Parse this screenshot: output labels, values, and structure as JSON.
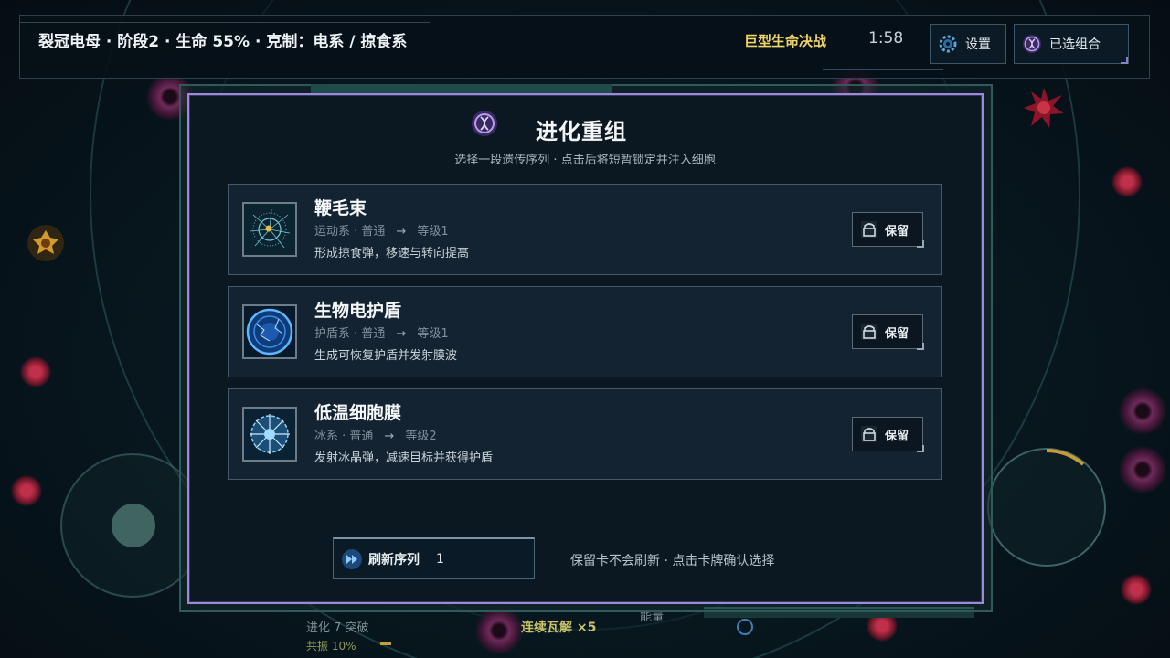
{
  "hud": {
    "boss_info": "裂冠电母 · 阶段2 · 生命 55% · 克制：电系 / 掠食系",
    "battle_name": "巨型生命决战",
    "timer": "1:58",
    "settings_label": "设置",
    "selected_combo_label": "已选组合",
    "bottom": {
      "evolution_text": "进化 7 突破",
      "resonance_text": "共振 10%",
      "chain_text": "连续瓦解 ×5",
      "energy_label": "能量"
    }
  },
  "modal": {
    "title": "进化重组",
    "subtitle": "选择一段遗传序列 · 点击后将短暂锁定并注入细胞",
    "cards": [
      {
        "name": "鞭毛束",
        "type": "运动系 · 普通",
        "arrow": "→",
        "level": "等级1",
        "desc": "形成掠食弹，移速与转向提高",
        "keep_label": "保留",
        "icon": "flagella-icon"
      },
      {
        "name": "生物电护盾",
        "type": "护盾系 · 普通",
        "arrow": "→",
        "level": "等级1",
        "desc": "生成可恢复护盾并发射膜波",
        "keep_label": "保留",
        "icon": "bioelectric-shield-icon"
      },
      {
        "name": "低温细胞膜",
        "type": "冰系 · 普通",
        "arrow": "→",
        "level": "等级2",
        "desc": "发射冰晶弹，减速目标并获得护盾",
        "keep_label": "保留",
        "icon": "cryo-membrane-icon"
      }
    ],
    "refresh_label": "刷新序列",
    "refresh_count": "1",
    "footer_hint": "保留卡不会刷新 · 点击卡牌确认选择"
  },
  "colors": {
    "accent_purple": "#9a8ad8",
    "gold_text": "#f0d56a",
    "panel_bg": "#0b1822",
    "card_bg": "#142332"
  }
}
